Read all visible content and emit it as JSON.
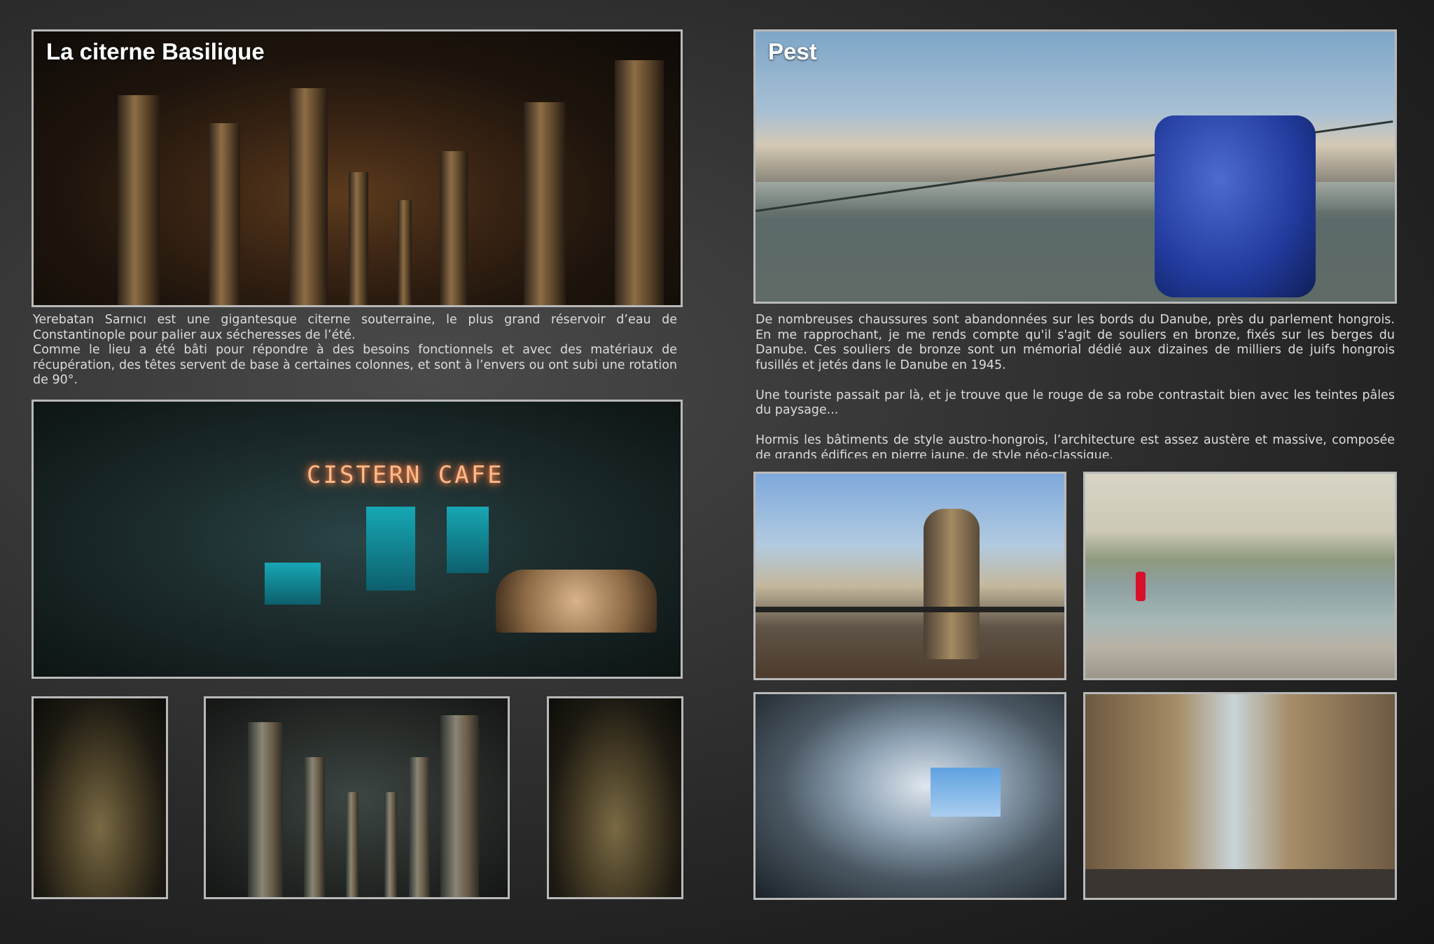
{
  "left": {
    "title": "La citerne Basilique",
    "paragraphs": [
      "Yerebatan Sarnıcı est une gigantesque citerne souterraine, le plus grand réservoir d’eau de Constantinople pour palier aux sécheresses de l’été.",
      "Comme le lieu a été bâti pour répondre à des besoins fonctionnels et avec des matériaux de récupération, des têtes servent de base à certaines colonnes, et sont à l’envers ou ont subi une rotation de 90°."
    ],
    "cafe_sign": "CISTERN CAFE"
  },
  "right": {
    "title": "Pest",
    "paragraphs": [
      "De nombreuses chaussures sont abandonnées sur les bords du Danube, près du parlement hongrois. En me rapprochant, je me rends compte qu'il s'agit de souliers en bronze, fixés sur les berges du Danube. Ces souliers de bronze sont un mémorial dédié aux dizaines de milliers de juifs hongrois fusillés et jetés dans le Danube en 1945.",
      "Une touriste passait par là, et je trouve que le rouge de sa robe contrastait bien avec les teintes pâles du paysage...",
      "Hormis les bâtiments de style austro-hongrois, l’architecture est assez austère et massive, composée de grands édifices en pierre jaune, de style néo-classique."
    ]
  },
  "colors": {
    "background": "#2e2e2e",
    "frame": "#b9b9b9",
    "text": "#dcdcdc",
    "title": "#ffffff"
  }
}
